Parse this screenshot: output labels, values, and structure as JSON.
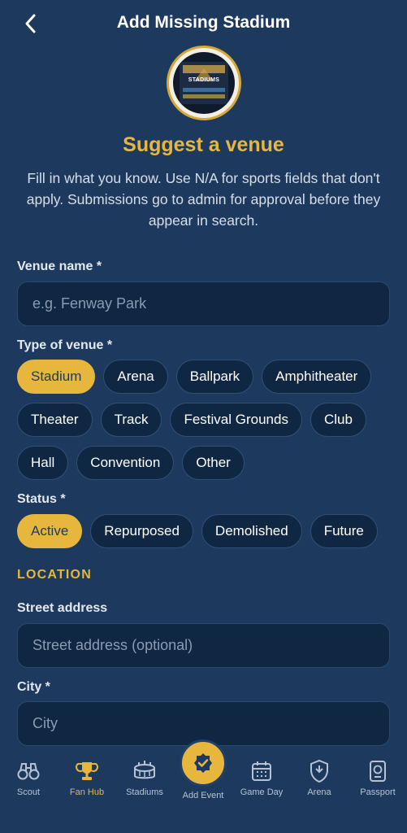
{
  "header": {
    "title": "Add Missing Stadium"
  },
  "logo": {
    "text": "STADIUMS"
  },
  "intro": {
    "title": "Suggest a venue",
    "description": "Fill in what you know. Use N/A for sports fields that don't apply. Submissions go to admin for approval before they appear in search."
  },
  "form": {
    "venue_name": {
      "label": "Venue name *",
      "placeholder": "e.g. Fenway Park",
      "value": ""
    },
    "type": {
      "label": "Type of venue *",
      "selected": "Stadium",
      "options": [
        "Stadium",
        "Arena",
        "Ballpark",
        "Amphitheater",
        "Theater",
        "Track",
        "Festival Grounds",
        "Club",
        "Hall",
        "Convention",
        "Other"
      ]
    },
    "status": {
      "label": "Status *",
      "selected": "Active",
      "options": [
        "Active",
        "Repurposed",
        "Demolished",
        "Future"
      ]
    },
    "location": {
      "section_title": "LOCATION",
      "street": {
        "label": "Street address",
        "placeholder": "Street address (optional)",
        "value": ""
      },
      "city": {
        "label": "City *",
        "placeholder": "City",
        "value": ""
      }
    }
  },
  "nav": {
    "items": [
      {
        "label": "Scout",
        "icon": "binoculars-icon",
        "active": false
      },
      {
        "label": "Fan Hub",
        "icon": "trophy-icon",
        "active": true
      },
      {
        "label": "Stadiums",
        "icon": "stadium-icon",
        "active": false
      },
      {
        "label": "Add Event",
        "icon": "check-badge-icon",
        "active": false
      },
      {
        "label": "Game Day",
        "icon": "calendar-icon",
        "active": false
      },
      {
        "label": "Arena",
        "icon": "shield-icon",
        "active": false
      },
      {
        "label": "Passport",
        "icon": "passport-icon",
        "active": false
      }
    ]
  },
  "colors": {
    "background": "#1d3a5e",
    "accent": "#e7b73d",
    "field": "#0f2743",
    "muted": "#b7c3d3"
  }
}
